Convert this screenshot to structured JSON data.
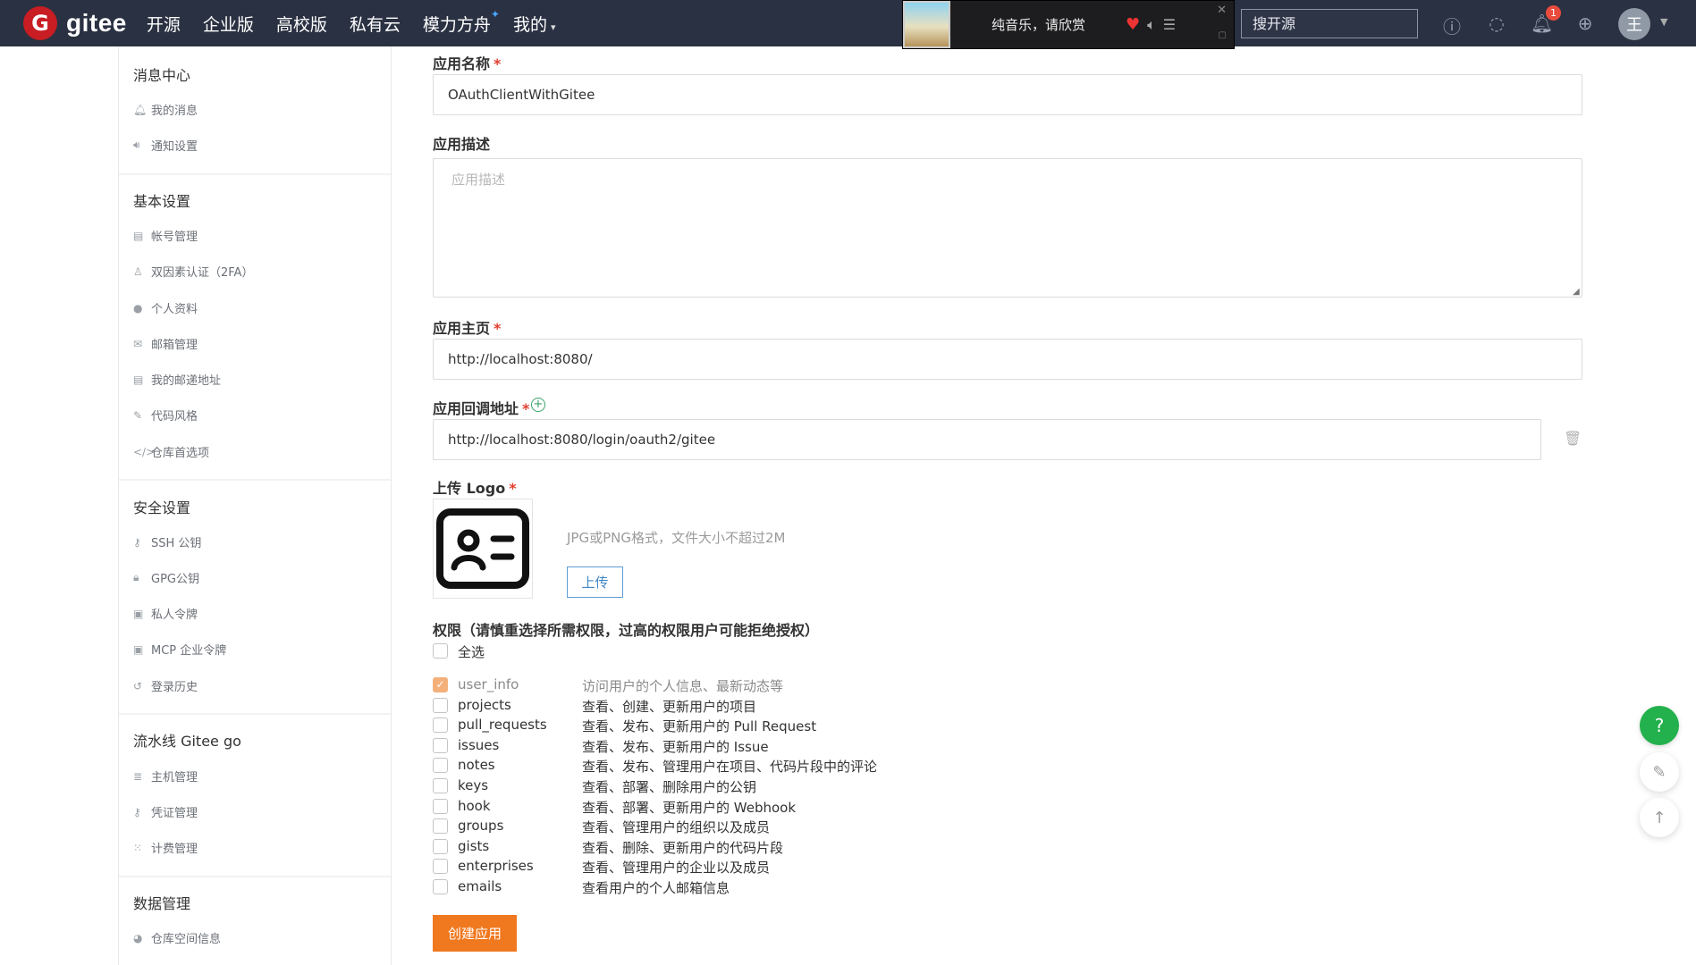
{
  "brand": {
    "badge": "G",
    "name": "gitee"
  },
  "nav": [
    {
      "label": "开源"
    },
    {
      "label": "企业版"
    },
    {
      "label": "高校版"
    },
    {
      "label": "私有云"
    },
    {
      "label": "模力方舟"
    },
    {
      "label": "我的"
    }
  ],
  "music": {
    "title": "纯音乐，请欣赏"
  },
  "search": {
    "placeholder": "搜开源"
  },
  "notifications": {
    "count": "1"
  },
  "user": {
    "avatar_text": "王"
  },
  "sidebar": {
    "sections": [
      {
        "title": "消息中心",
        "items": [
          {
            "icon": "bell-icon",
            "label": "我的消息"
          },
          {
            "icon": "speaker-icon",
            "label": "通知设置"
          }
        ]
      },
      {
        "title": "基本设置",
        "items": [
          {
            "icon": "id-card-icon",
            "label": "帐号管理"
          },
          {
            "icon": "user-shield-icon",
            "label": "双因素认证（2FA）"
          },
          {
            "icon": "user-icon",
            "label": "个人资料"
          },
          {
            "icon": "mail-icon",
            "label": "邮箱管理"
          },
          {
            "icon": "address-card-icon",
            "label": "我的邮递地址"
          },
          {
            "icon": "brush-icon",
            "label": "代码风格"
          },
          {
            "icon": "code-icon",
            "label": "仓库首选项"
          }
        ]
      },
      {
        "title": "安全设置",
        "items": [
          {
            "icon": "key-icon",
            "label": "SSH 公钥"
          },
          {
            "icon": "lock-icon",
            "label": "GPG公钥"
          },
          {
            "icon": "token-icon",
            "label": "私人令牌"
          },
          {
            "icon": "token-icon",
            "label": "MCP 企业令牌"
          },
          {
            "icon": "history-icon",
            "label": "登录历史"
          }
        ]
      },
      {
        "title": "流水线 Gitee go",
        "items": [
          {
            "icon": "server-icon",
            "label": "主机管理"
          },
          {
            "icon": "key-icon",
            "label": "凭证管理"
          },
          {
            "icon": "billing-icon",
            "label": "计费管理"
          }
        ]
      },
      {
        "title": "数据管理",
        "items": [
          {
            "icon": "pie-chart-icon",
            "label": "仓库空间信息"
          }
        ]
      }
    ]
  },
  "form": {
    "app_name": {
      "label": "应用名称",
      "required": "*",
      "value": "OAuthClientWithGitee"
    },
    "app_desc": {
      "label": "应用描述",
      "placeholder": "应用描述"
    },
    "homepage": {
      "label": "应用主页",
      "required": "*",
      "value": "http://localhost:8080/"
    },
    "callback": {
      "label": "应用回调地址",
      "required": "*",
      "value": "http://localhost:8080/login/oauth2/gitee"
    },
    "logo": {
      "label": "上传 Logo",
      "required": "*",
      "tip": "JPG或PNG格式，文件大小不超过2M",
      "upload_label": "上传"
    },
    "scopes_title": "权限（请慎重选择所需权限，过高的权限用户可能拒绝授权）",
    "select_all": "全选",
    "scopes": [
      {
        "name": "user_info",
        "desc": "访问用户的个人信息、最新动态等",
        "checked": true
      },
      {
        "name": "projects",
        "desc": "查看、创建、更新用户的项目",
        "checked": false
      },
      {
        "name": "pull_requests",
        "desc": "查看、发布、更新用户的 Pull Request",
        "checked": false
      },
      {
        "name": "issues",
        "desc": "查看、发布、更新用户的 Issue",
        "checked": false
      },
      {
        "name": "notes",
        "desc": "查看、发布、管理用户在项目、代码片段中的评论",
        "checked": false
      },
      {
        "name": "keys",
        "desc": "查看、部署、删除用户的公钥",
        "checked": false
      },
      {
        "name": "hook",
        "desc": "查看、部署、更新用户的 Webhook",
        "checked": false
      },
      {
        "name": "groups",
        "desc": "查看、管理用户的组织以及成员",
        "checked": false
      },
      {
        "name": "gists",
        "desc": "查看、删除、更新用户的代码片段",
        "checked": false
      },
      {
        "name": "enterprises",
        "desc": "查看、管理用户的企业以及成员",
        "checked": false
      },
      {
        "name": "emails",
        "desc": "查看用户的个人邮箱信息",
        "checked": false
      }
    ],
    "submit_label": "创建应用"
  },
  "float": {
    "help": "?"
  }
}
